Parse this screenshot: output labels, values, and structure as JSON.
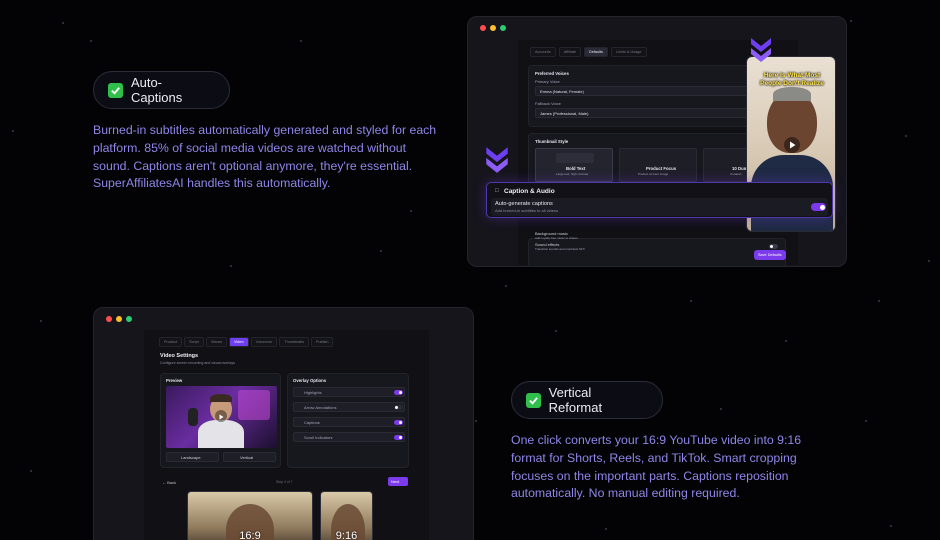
{
  "features": [
    {
      "title": "Auto-Captions",
      "description": "Burned-in subtitles automatically generated and styled for each platform. 85% of social media videos are watched without sound. Captions aren't optional anymore, they're essential. SuperAffiliatesAI handles this automatically."
    },
    {
      "title": "Vertical Reformat",
      "description": "One click converts your 16:9 YouTube video into 9:16 format for Shorts, Reels, and TikTok. Smart cropping focuses on the important parts. Captions reposition automatically. No manual editing required."
    }
  ],
  "captions_window": {
    "tabs": [
      "Accounts",
      "Affiliate",
      "Defaults",
      "Limits & Usage"
    ],
    "active_tab": "Defaults",
    "preferred_voices": {
      "title": "Preferred Voices",
      "primary_label": "Primary Voice",
      "primary_value": "Emma (Natural, Female)",
      "fallback_label": "Fallback Voice",
      "fallback_value": "James (Professional, Male)"
    },
    "thumbnail_style": {
      "title": "Thumbnail Style",
      "options": [
        {
          "name": "Bold Text",
          "sub": "Large text, high contrast"
        },
        {
          "name": "Product Focus",
          "sub": "Product as hero image"
        },
        {
          "name": "10 Dum",
          "sub": "Curated..."
        }
      ]
    },
    "caption_popup": {
      "title": "Caption & Audio",
      "setting": "Auto-generate captions",
      "setting_sub": "Add burned-in subtitles to all videos",
      "enabled": true
    },
    "background_music": {
      "label": "Background music",
      "sub": "Add royalty-free music to videos"
    },
    "sound_effects": {
      "label": "Sound effects",
      "sub": "Transition sounds and emphasis SFX"
    },
    "save_button": "Save Defaults",
    "phone_caption": "Here Is What Most People Don't Realize"
  },
  "reformat_window": {
    "tabs": [
      "Product",
      "Script",
      "Voices",
      "Video",
      "Voiceover",
      "Thumbnails",
      "Publish"
    ],
    "active_tab": "Video",
    "title": "Video Settings",
    "subtitle": "Configure screen recording and visual overlays",
    "preview_label": "Preview",
    "landscape_button": "Landscape",
    "vertical_button": "Vertical",
    "overlay_title": "Overlay Options",
    "overlay_options": [
      {
        "label": "Highlights",
        "enabled": true
      },
      {
        "label": "Arrow Annotations",
        "enabled": false
      },
      {
        "label": "Captions",
        "enabled": true
      },
      {
        "label": "Scroll Indicators",
        "enabled": true
      }
    ],
    "back_label": "Back",
    "step_label": "Step 4 of 7",
    "next_label": "Next",
    "ratio_landscape": "16:9",
    "ratio_vertical": "9:16"
  },
  "colors": {
    "accent": "#7c3aed",
    "description_text": "#8f86e8",
    "check_green": "#2fbf4a",
    "background": "#030306"
  }
}
